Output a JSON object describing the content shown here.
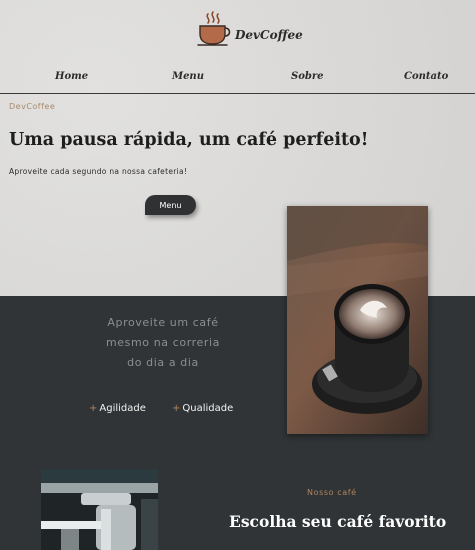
{
  "brand": {
    "name": "DevCoffee"
  },
  "nav": {
    "items": [
      "Home",
      "Menu",
      "Sobre",
      "Contato"
    ]
  },
  "hero": {
    "eyebrow": "DevCoffee",
    "title": "Uma pausa rápida, um café perfeito!",
    "subtitle": "Aproveite cada segundo na nossa cafeteria!",
    "button_label": "Menu"
  },
  "about": {
    "quote_lines": [
      "Aproveite um café",
      "mesmo na correria",
      "do dia a dia"
    ],
    "features": [
      "Agilidade",
      "Qualidade"
    ]
  },
  "menu_section": {
    "eyebrow": "Nosso café",
    "title": "Escolha seu café favorito"
  },
  "icons": [
    "coffee-cup-icon",
    "plus-icon"
  ],
  "colors": {
    "dark_bg": "#303436",
    "accent": "#b0865e",
    "light_bg": "#dcdbd9"
  }
}
